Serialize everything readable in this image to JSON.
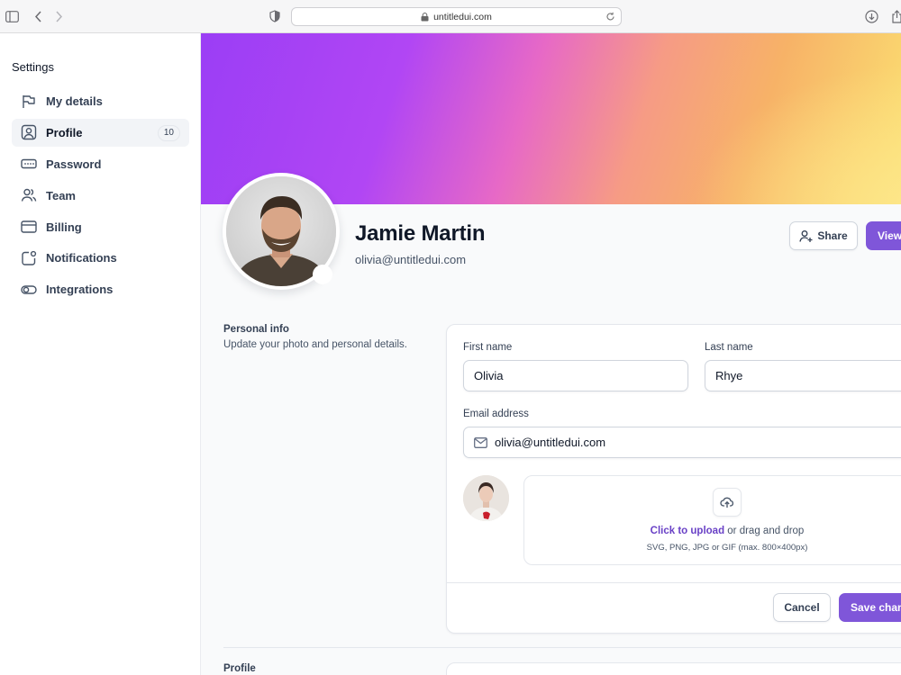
{
  "browser": {
    "url": "untitledui.com",
    "icons": [
      "sidebar-toggle-icon",
      "back-icon",
      "forward-icon",
      "shield-icon",
      "lock-icon",
      "reload-icon",
      "download-icon",
      "share-icon"
    ]
  },
  "sidebar": {
    "title": "Settings",
    "items": [
      {
        "label": "My details",
        "icon": "flag-icon",
        "active": false
      },
      {
        "label": "Profile",
        "icon": "user-square-icon",
        "active": true,
        "badge": "10"
      },
      {
        "label": "Password",
        "icon": "password-icon",
        "active": false
      },
      {
        "label": "Team",
        "icon": "users-icon",
        "active": false
      },
      {
        "label": "Billing",
        "icon": "credit-card-icon",
        "active": false
      },
      {
        "label": "Notifications",
        "icon": "notification-box-icon",
        "active": false
      },
      {
        "label": "Integrations",
        "icon": "toggle-icon",
        "active": false
      }
    ]
  },
  "profile": {
    "name": "Jamie Martin",
    "email": "olivia@untitledui.com",
    "share_label": "Share",
    "view_label": "View"
  },
  "personal_info": {
    "title": "Personal info",
    "description": "Update your photo and personal details.",
    "first_name_label": "First name",
    "first_name_value": "Olivia",
    "last_name_label": "Last name",
    "last_name_value": "Rhye",
    "email_label": "Email address",
    "email_value": "olivia@untitledui.com",
    "upload_link": "Click to upload",
    "upload_text": " or drag and drop",
    "upload_hint": "SVG, PNG, JPG or GIF (max. 800×400px)",
    "cancel_label": "Cancel",
    "save_label": "Save changes"
  },
  "next_section": {
    "title": "Profile"
  },
  "colors": {
    "accent": "#7f56d9",
    "link": "#6941c6",
    "active_nav_bg": "#f2f4f7"
  }
}
